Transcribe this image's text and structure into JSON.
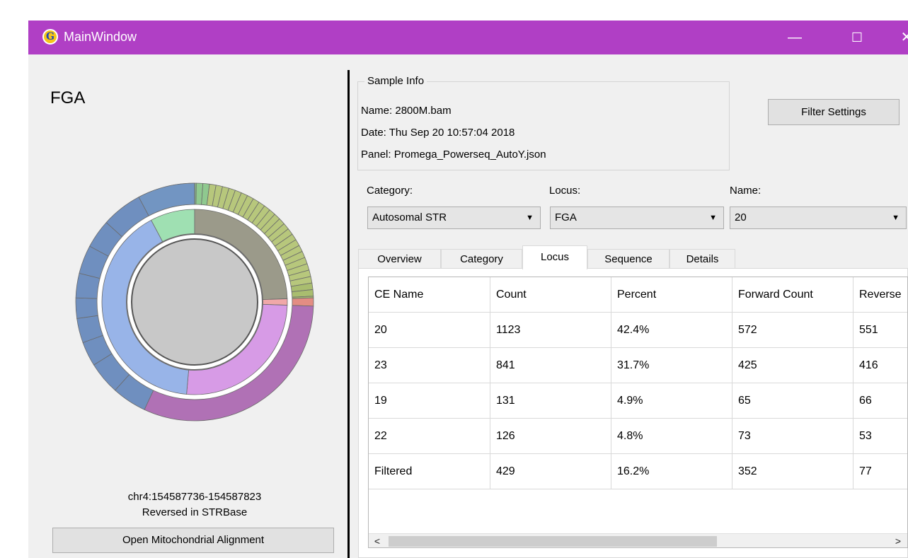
{
  "window": {
    "title": "MainWindow",
    "controls": {
      "minimize": "—",
      "maximize": "☐",
      "close": "✕"
    },
    "titlebar_color": "#b03fc5"
  },
  "left_panel": {
    "locus_title": "FGA",
    "coordinates": "chr4:154587736-154587823",
    "strbase_note": "Reversed in STRBase",
    "mito_button": "Open Mitochondrial Alignment"
  },
  "sample_info": {
    "group_title": "Sample Info",
    "name_line": "Name:  2800M.bam",
    "date_line": "Date:   Thu Sep 20 10:57:04 2018",
    "panel_line": "Panel:  Promega_Powerseq_AutoY.json"
  },
  "filter_button": "Filter Settings",
  "selectors": {
    "category": {
      "label": "Category:",
      "value": "Autosomal STR"
    },
    "locus": {
      "label": "Locus:",
      "value": "FGA"
    },
    "name": {
      "label": "Name:",
      "value": "20"
    }
  },
  "tabs": [
    "Overview",
    "Category",
    "Locus",
    "Sequence",
    "Details"
  ],
  "active_tab": "Locus",
  "table": {
    "columns": [
      "CE Name",
      "Count",
      "Percent",
      "Forward Count",
      "Reverse"
    ],
    "rows": [
      [
        "20",
        "1123",
        "42.4%",
        "572",
        "551"
      ],
      [
        "23",
        "841",
        "31.7%",
        "425",
        "416"
      ],
      [
        "19",
        "131",
        "4.9%",
        "65",
        "66"
      ],
      [
        "22",
        "126",
        "4.8%",
        "73",
        "53"
      ],
      [
        "Filtered",
        "429",
        "16.2%",
        "352",
        "77"
      ]
    ]
  },
  "scrollbar": {
    "left_arrow": "<",
    "right_arrow": ">"
  }
}
